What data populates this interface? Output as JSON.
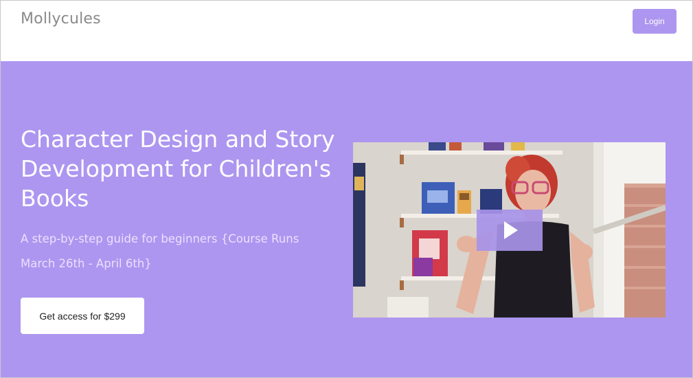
{
  "header": {
    "brand": "Mollycules",
    "login_label": "Login"
  },
  "hero": {
    "title": "Character Design and Story Development for Children's Books",
    "subtitle": "A step-by-step guide for beginners {Course Runs March 26th - April 6th}",
    "cta_label": "Get access for $299"
  },
  "video": {
    "play_icon": "play-icon"
  },
  "colors": {
    "accent": "#ad96f0",
    "cta_background": "#ffffff",
    "brand_text": "#8a8a8a"
  }
}
